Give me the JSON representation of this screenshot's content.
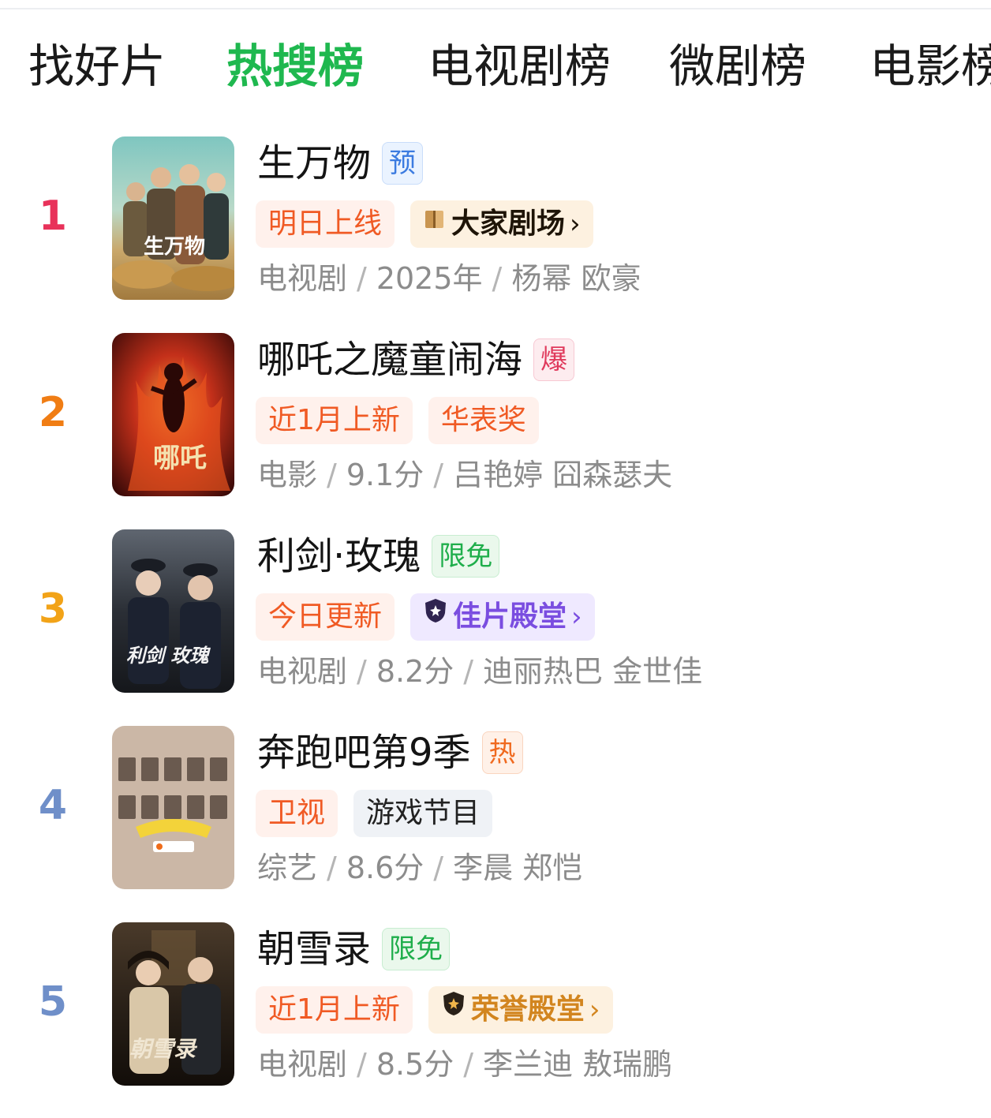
{
  "tabs": [
    {
      "label": "找好片",
      "active": false
    },
    {
      "label": "热搜榜",
      "active": true
    },
    {
      "label": "电视剧榜",
      "active": false
    },
    {
      "label": "微剧榜",
      "active": false
    },
    {
      "label": "电影榜",
      "active": false
    }
  ],
  "colors": {
    "active_tab": "#1fb84f",
    "rank_1": "#e8325a",
    "rank_2": "#f07d14",
    "rank_3": "#f2a318",
    "rank_4_5": "#6f8fc9"
  },
  "items": [
    {
      "rank": "1",
      "title": "生万物",
      "flag": {
        "text": "预",
        "kind": "blue"
      },
      "tags": [
        {
          "text": "明日上线",
          "kind": "orange"
        },
        {
          "text": "大家剧场",
          "kind": "gold",
          "icon": "book-icon",
          "chevron": "›"
        }
      ],
      "meta": [
        "电视剧",
        "2025年",
        "杨幂 欧豪"
      ]
    },
    {
      "rank": "2",
      "title": "哪吒之魔童闹海",
      "flag": {
        "text": "爆",
        "kind": "pink"
      },
      "tags": [
        {
          "text": "近1月上新",
          "kind": "orange"
        },
        {
          "text": "华表奖",
          "kind": "orange"
        }
      ],
      "meta": [
        "电影",
        "9.1分",
        "吕艳婷 囧森瑟夫"
      ]
    },
    {
      "rank": "3",
      "title": "利剑·玫瑰",
      "flag": {
        "text": "限免",
        "kind": "green"
      },
      "tags": [
        {
          "text": "今日更新",
          "kind": "orange"
        },
        {
          "text": "佳片殿堂",
          "kind": "purple",
          "icon": "shield-star-icon",
          "chevron": "›"
        }
      ],
      "meta": [
        "电视剧",
        "8.2分",
        "迪丽热巴 金世佳"
      ]
    },
    {
      "rank": "4",
      "title": "奔跑吧第9季",
      "flag": {
        "text": "热",
        "kind": "orange"
      },
      "tags": [
        {
          "text": "卫视",
          "kind": "orange"
        },
        {
          "text": "游戏节目",
          "kind": "gray"
        }
      ],
      "meta": [
        "综艺",
        "8.6分",
        "李晨 郑恺"
      ]
    },
    {
      "rank": "5",
      "title": "朝雪录",
      "flag": {
        "text": "限免",
        "kind": "green"
      },
      "tags": [
        {
          "text": "近1月上新",
          "kind": "orange"
        },
        {
          "text": "荣誉殿堂",
          "kind": "honor",
          "icon": "shield-star-icon",
          "chevron": "›"
        }
      ],
      "meta": [
        "电视剧",
        "8.5分",
        "李兰迪 敖瑞鹏"
      ]
    }
  ]
}
